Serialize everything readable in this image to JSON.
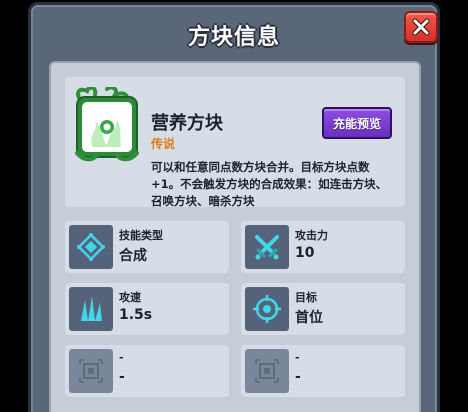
{
  "panel": {
    "title": "方块信息"
  },
  "block": {
    "name": "营养方块",
    "rarity": "传说",
    "preview_label": "充能预览",
    "description_lines": [
      "可以和任意同点数方块合并。目标方块点数",
      "+1。不会触发方块的合成效果：如连击方块、",
      "召唤方块、暗杀方块"
    ],
    "icon": "green-leaf-block-icon"
  },
  "stats": [
    {
      "label": "技能类型",
      "value": "合成",
      "icon": "merge-diamond-icon"
    },
    {
      "label": "攻击力",
      "value": "10",
      "icon": "crossed-swords-icon"
    },
    {
      "label": "攻速",
      "value": "1.5s",
      "icon": "speed-spikes-icon"
    },
    {
      "label": "目标",
      "value": "首位",
      "icon": "target-crosshair-icon"
    },
    {
      "label": "-",
      "value": "-",
      "icon": "empty-slot-icon"
    },
    {
      "label": "-",
      "value": "-",
      "icon": "empty-slot-icon"
    }
  ],
  "colors": {
    "panel": "#5a6779",
    "inner": "#c5cdd8",
    "card": "#d6dde6",
    "close": "#e2453a",
    "preview": "#7b3fd0",
    "rarity": "#e07d14",
    "icon_accent": "#41d6e8"
  }
}
